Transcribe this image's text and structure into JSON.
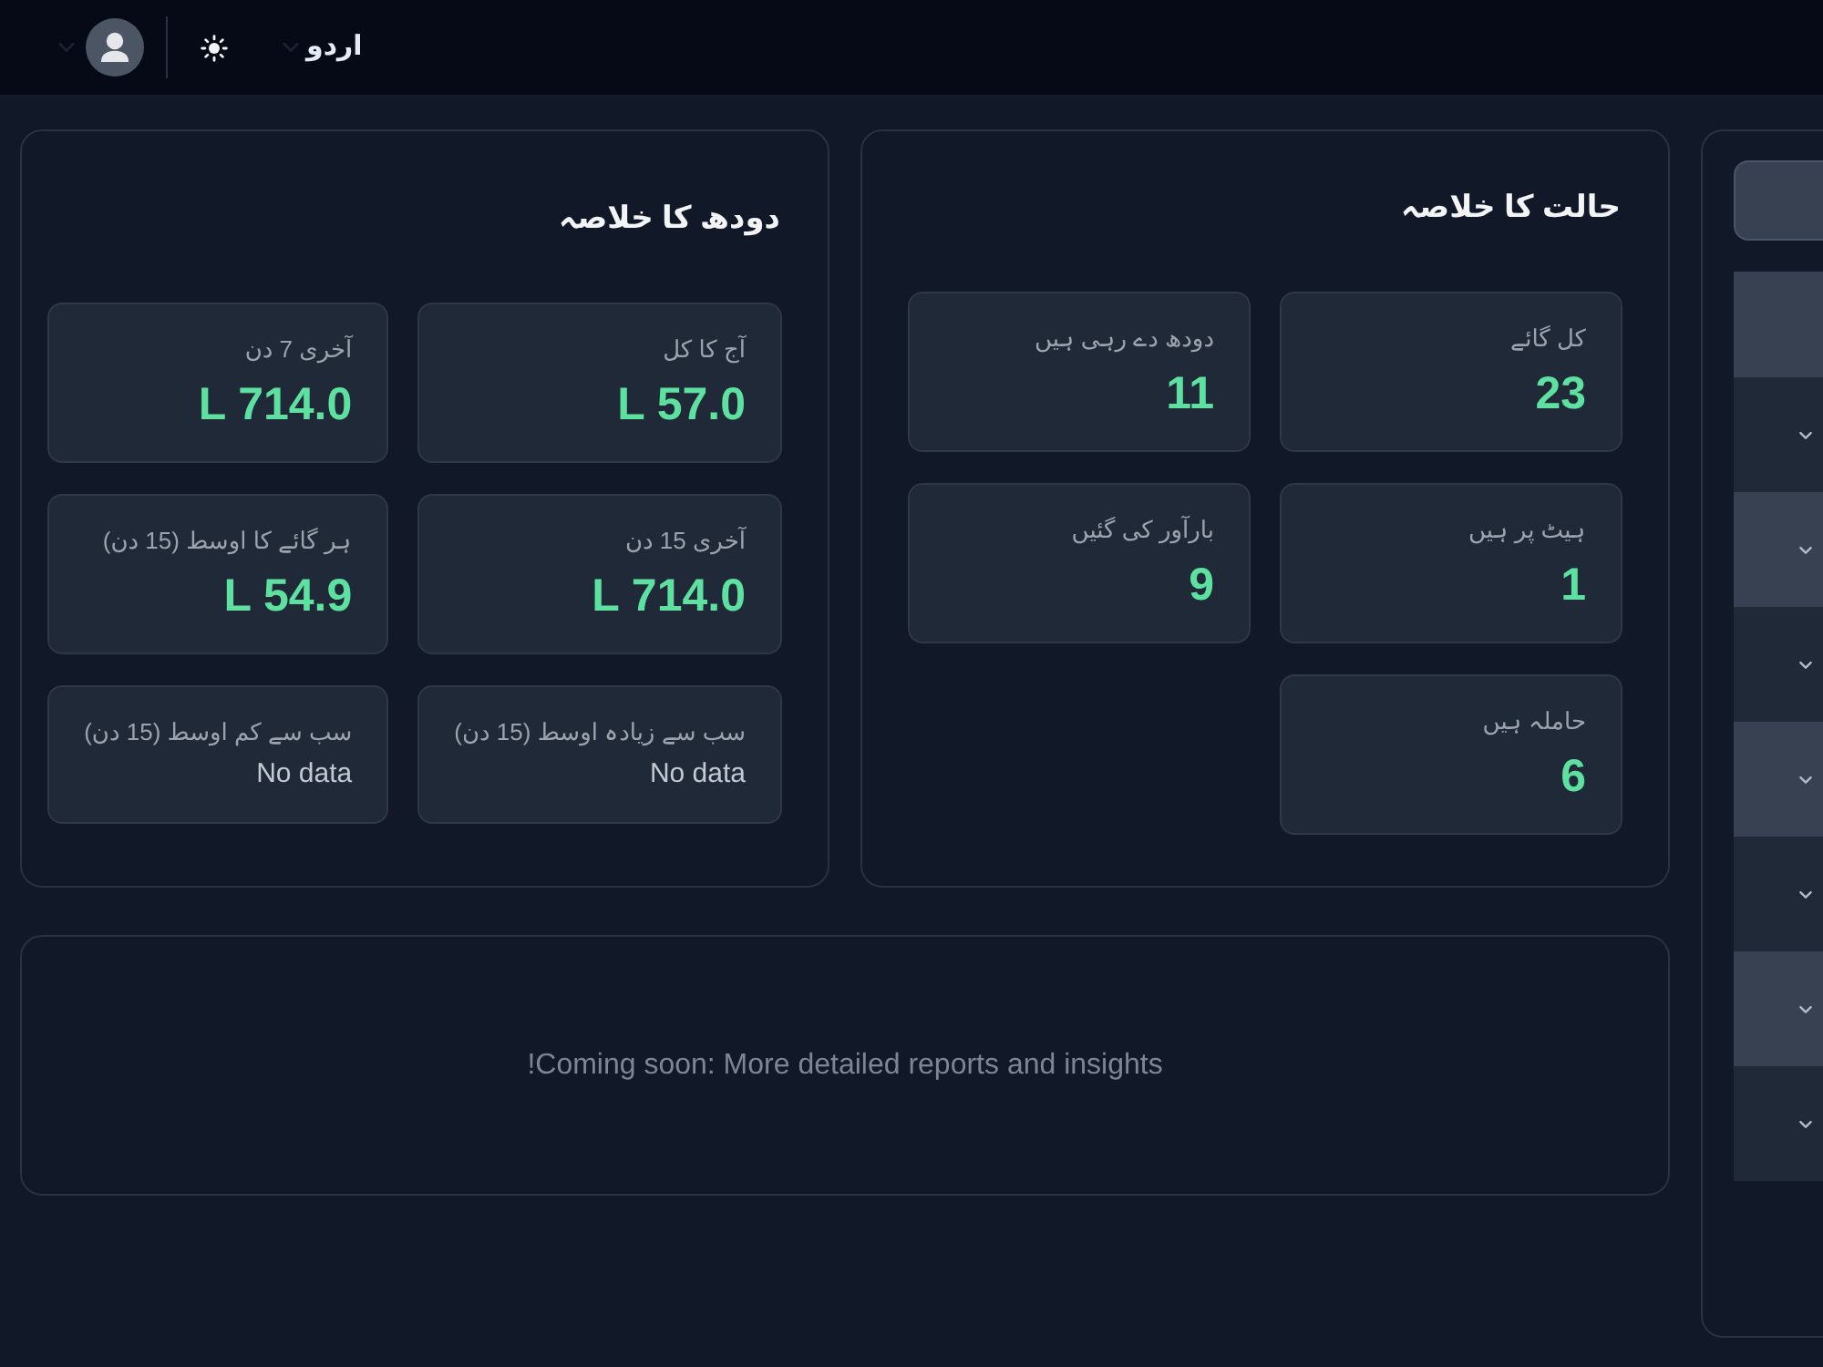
{
  "header": {
    "language": "اردو"
  },
  "sidebar": {
    "rows": [
      {
        "kind": "header"
      },
      {
        "kind": "group",
        "expanded": false
      },
      {
        "kind": "group",
        "expanded": false
      },
      {
        "kind": "group",
        "expanded": false
      },
      {
        "kind": "group",
        "expanded": false
      },
      {
        "kind": "group",
        "expanded": false
      },
      {
        "kind": "group",
        "expanded": false
      },
      {
        "kind": "group",
        "expanded": false
      }
    ]
  },
  "status_summary": {
    "title": "حالت کا خلاصہ",
    "tiles": [
      {
        "label": "کل گائے",
        "value": "23"
      },
      {
        "label": "دودھ دے رہی ہیں",
        "value": "11"
      },
      {
        "label": "ہیٹ پر ہیں",
        "value": "1"
      },
      {
        "label": "بارآور کی گئیں",
        "value": "9"
      },
      {
        "label": "حاملہ ہیں",
        "value": "6"
      }
    ]
  },
  "milk_summary": {
    "title": "دودھ کا خلاصہ",
    "tiles": [
      {
        "label": "آج کا کل",
        "value": "L 57.0",
        "kind": "metric"
      },
      {
        "label": "آخری 7 دن",
        "value": "L 714.0",
        "kind": "metric"
      },
      {
        "label": "آخری 15 دن",
        "value": "L 714.0",
        "kind": "metric"
      },
      {
        "label": "ہر گائے کا اوسط (15 دن)",
        "value": "L 54.9",
        "kind": "metric"
      },
      {
        "label": "سب سے زیادہ اوسط (15 دن)",
        "value": "No data",
        "kind": "empty"
      },
      {
        "label": "سب سے کم اوسط (15 دن)",
        "value": "No data",
        "kind": "empty"
      }
    ]
  },
  "notice": {
    "text": "Coming soon: More detailed reports and insights!"
  }
}
